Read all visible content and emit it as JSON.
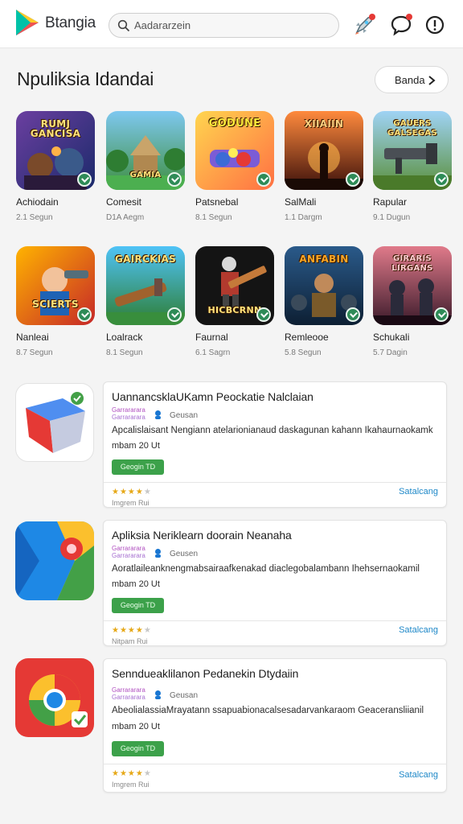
{
  "header": {
    "brand": "Btangia",
    "search_value": "Aadararzein",
    "icons": [
      "play-logo-icon",
      "search-icon",
      "rocket-icon",
      "chat-bubble-icon",
      "info-icon"
    ],
    "colors": {
      "accent_green": "#3ca14a",
      "link_blue": "#1e88c8",
      "notification_red": "#e53935"
    }
  },
  "games_section": {
    "title": "Npuliksia Idandai",
    "more_label": "Banda",
    "items": [
      {
        "name": "Achiodain",
        "meta": "2.1 Segun",
        "art_title": "RUMJ GANCISA"
      },
      {
        "name": "Comesit",
        "meta": "D1A Aegm",
        "art_title": "GAMIA"
      },
      {
        "name": "Patsnebal",
        "meta": "8.1 Segun",
        "art_title": "GODUNE"
      },
      {
        "name": "SalMali",
        "meta": "1.1 Dargm",
        "art_title": "XIIAIIN"
      },
      {
        "name": "Rapular",
        "meta": "9.1 Dugun",
        "art_title": "GAUERS GALSEGAS"
      },
      {
        "name": "Nanleai",
        "meta": "8.7 Segun",
        "art_title": "SCIERTS"
      },
      {
        "name": "Loalrack",
        "meta": "8.1 Segun",
        "art_title": "GAIRCKIAS"
      },
      {
        "name": "Faurnal",
        "meta": "6.1 Sagrn",
        "art_title": "HICBCRNN"
      },
      {
        "name": "Remleooe",
        "meta": "5.8 Segun",
        "art_title": "ANFABIN"
      },
      {
        "name": "Schukali",
        "meta": "5.7 Dagin",
        "art_title": "GIRARIS LIRGANS"
      }
    ]
  },
  "apps": [
    {
      "title": "UannancsklaUKamn Peockatie Nalclaian",
      "dev_line1": "Garrararara",
      "dev_line2": "Garrararara",
      "category": "Geusan",
      "description": "Apcalislaisant Nengiann atelarionianaud daskagunan kahann Ikahaurnaokamk",
      "size": "mbam 20 Ut",
      "install_label": "Geogin TD",
      "rating": 4,
      "reviews": "Imgrem Rui",
      "link": "Satalcang"
    },
    {
      "title": "Apliksia Neriklearn doorain Neanaha",
      "dev_line1": "Garrararara",
      "dev_line2": "Garrararara",
      "category": "Geusen",
      "description": "Aoratlaileanknengmabsairaafkenakad diaclegobalambann Ihehsernaokamil",
      "size": "mbam 20 Ut",
      "install_label": "Geogin TD",
      "rating": 4,
      "reviews": "Nitpam Rui",
      "link": "Satalcang"
    },
    {
      "title": "Senndueaklilanon Pedanekin Dtydaiin",
      "dev_line1": "Garrararara",
      "dev_line2": "Garrararara",
      "category": "Geusan",
      "description": "AbeolialassiaMrayatann ssapuabionacalsesadarvankaraom Geaceransliianil",
      "size": "mbam 20 Ut",
      "install_label": "Geogin TD",
      "rating": 4,
      "reviews": "Imgrem Rui",
      "link": "Satalcang"
    }
  ]
}
